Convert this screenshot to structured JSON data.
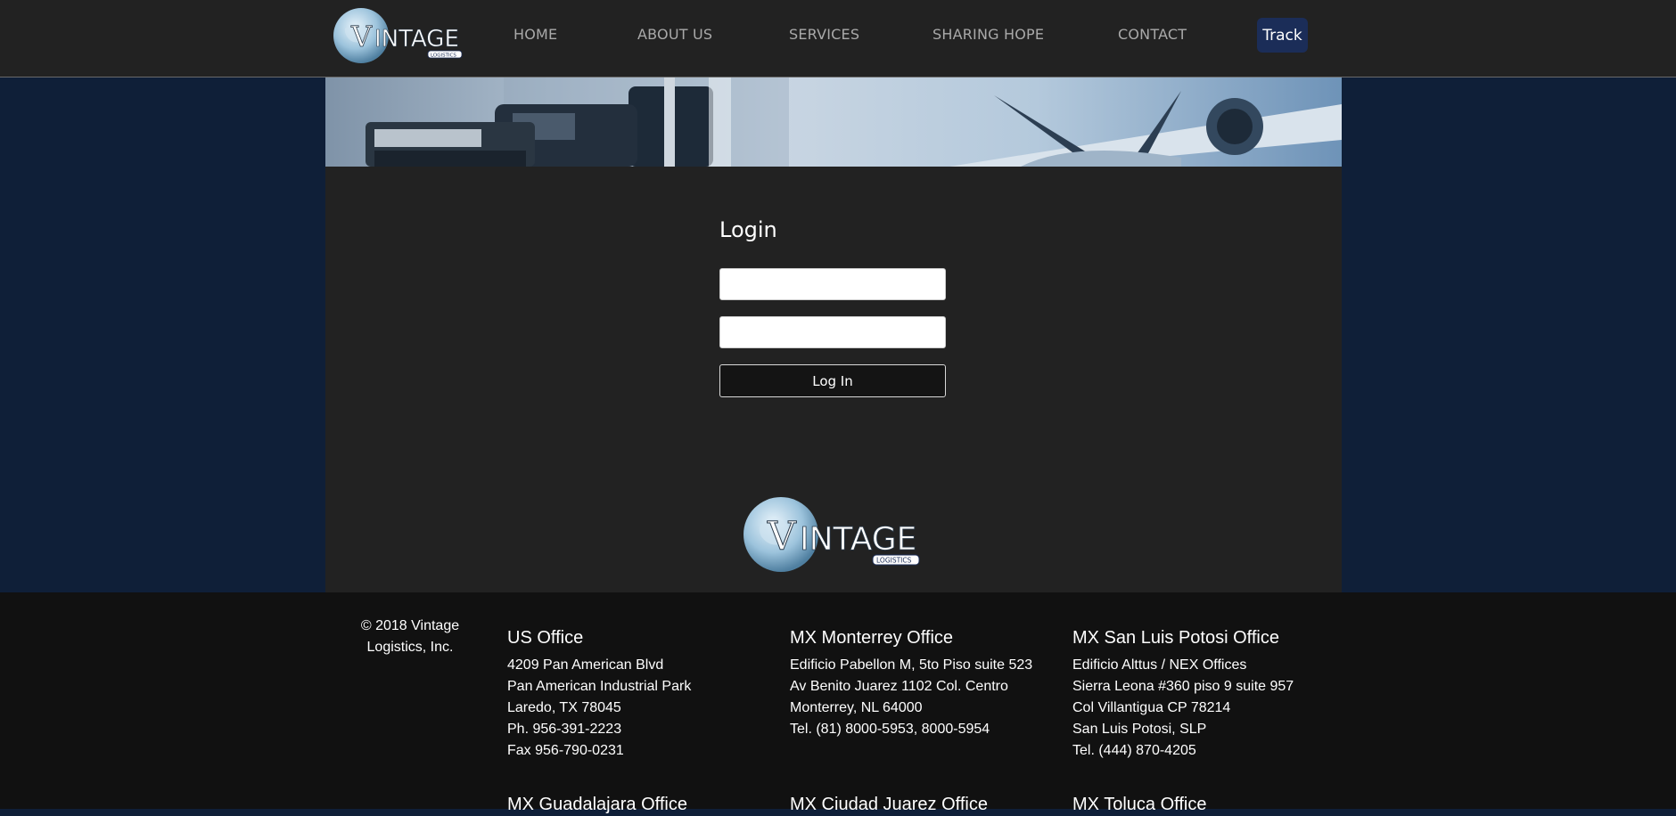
{
  "brand": {
    "logo_text": "VINTAGE",
    "logo_subtext": "LOGISTICS"
  },
  "nav": {
    "items": [
      {
        "label": "HOME"
      },
      {
        "label": "ABOUT US"
      },
      {
        "label": "SERVICES"
      },
      {
        "label": "SHARING HOPE"
      },
      {
        "label": "CONTACT"
      }
    ],
    "track_label": "Track"
  },
  "login": {
    "title": "Login",
    "username_value": "",
    "password_value": "",
    "button_label": "Log In"
  },
  "footer": {
    "copyright_line1": "© 2018 Vintage",
    "copyright_line2": "Logistics, Inc.",
    "offices": [
      {
        "title": "US Office",
        "lines": [
          "4209 Pan American Blvd",
          "Pan American Industrial Park",
          "Laredo, TX 78045",
          "Ph. 956-391-2223",
          "Fax 956-790-0231"
        ]
      },
      {
        "title": "MX Monterrey Office",
        "lines": [
          "Edificio Pabellon M, 5to Piso suite 523",
          "Av Benito Juarez 1102 Col. Centro",
          "Monterrey, NL 64000",
          "Tel. (81) 8000-5953, 8000-5954"
        ]
      },
      {
        "title": "MX San Luis Potosi Office",
        "lines": [
          "Edificio Alttus / NEX Offices",
          "Sierra Leona #360 piso 9 suite 957",
          "Col Villantigua CP 78214",
          "San Luis Potosi, SLP",
          "Tel. (444) 870-4205"
        ]
      },
      {
        "title": "MX Guadalajara Office",
        "lines": []
      },
      {
        "title": "MX Ciudad Juarez Office",
        "lines": []
      },
      {
        "title": "MX Toluca Office",
        "lines": []
      }
    ]
  },
  "colors": {
    "page_bg": "#0f1f38",
    "header_bg": "#222222",
    "panel_bg": "#222222",
    "footer_bg": "#111111",
    "track_bg": "#1b2d58",
    "nav_text": "#a9a9a9"
  }
}
